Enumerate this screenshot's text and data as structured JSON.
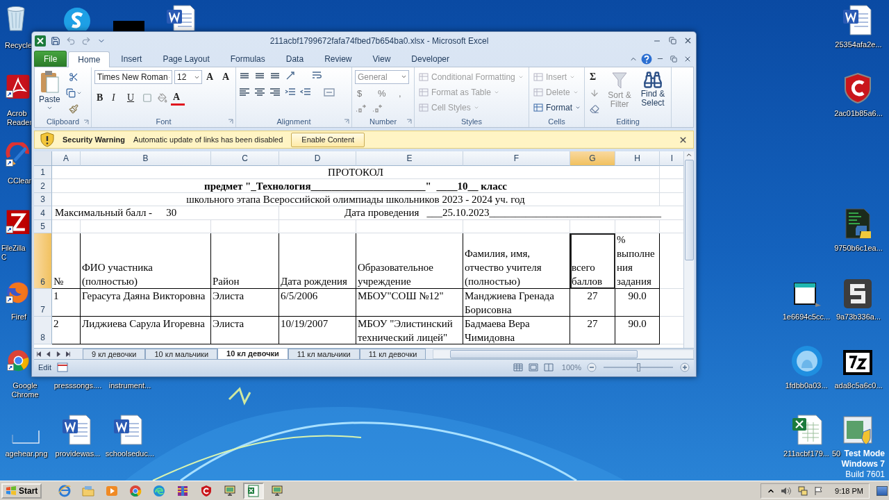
{
  "desktop": {
    "icons": [
      {
        "kind": "recycle",
        "label": "Recycle"
      },
      {
        "kind": "skype"
      },
      {
        "kind": "blackbox"
      },
      {
        "kind": "word"
      },
      {
        "kind": "acrobat",
        "label": "Acrob Reader"
      },
      {
        "kind": "ccleaner",
        "label": "CClear"
      },
      {
        "kind": "filezilla",
        "label": "FileZilla C"
      },
      {
        "kind": "firefox",
        "label": "Firef"
      },
      {
        "kind": "chrome",
        "label": "Google Chrome"
      },
      {
        "label": "presssongs...."
      },
      {
        "label": "instrument..."
      },
      {
        "kind": "imagefile",
        "label": "agehear.png"
      },
      {
        "kind": "word",
        "label": "providewas..."
      },
      {
        "kind": "word",
        "label": "schoolseduc..."
      },
      {
        "kind": "word",
        "label": "25354afa2e..."
      },
      {
        "kind": "shield",
        "label": "2ac01b85a6..."
      },
      {
        "kind": "python",
        "label": "9750b6c1ea..."
      },
      {
        "kind": "window",
        "label": "1e6694c5cc..."
      },
      {
        "kind": "sapp",
        "label": "9a73b336a..."
      },
      {
        "kind": "bubble",
        "label": "1fdbb0a03..."
      },
      {
        "kind": "sevenzip",
        "label": "ada8c5a6c0..."
      },
      {
        "kind": "excelfile",
        "label": "211acbf179..."
      },
      {
        "kind": "installer",
        "label": "50"
      }
    ],
    "notice": [
      "Test Mode",
      "Windows 7",
      "Build 7601"
    ]
  },
  "excel": {
    "title": "211acbf1799672fafa74fbed7b654ba0.xlsx - Microsoft Excel",
    "tabs": [
      {
        "label": "File",
        "kind": "file",
        "selected": false
      },
      {
        "label": "Home",
        "kind": "tab",
        "selected": true
      },
      {
        "label": "Insert",
        "kind": "tab",
        "selected": false
      },
      {
        "label": "Page Layout",
        "kind": "tab",
        "selected": false
      },
      {
        "label": "Formulas",
        "kind": "tab",
        "selected": false
      },
      {
        "label": "Data",
        "kind": "tab",
        "selected": false
      },
      {
        "label": "Review",
        "kind": "tab",
        "selected": false
      },
      {
        "label": "View",
        "kind": "tab",
        "selected": false
      },
      {
        "label": "Developer",
        "kind": "tab",
        "selected": false
      }
    ],
    "ribbon": [
      {
        "kind": "clipboard",
        "label": "Clipboard",
        "paste": "Paste"
      },
      {
        "kind": "font",
        "label": "Font",
        "font_name": "Times New Roman",
        "font_size": "12",
        "grow": "A",
        "shrink": "A",
        "bold": "B",
        "italic": "I",
        "underline": "U",
        "color_letter": "A"
      },
      {
        "kind": "alignment",
        "label": "Alignment"
      },
      {
        "kind": "number",
        "label": "Number",
        "format": "General",
        "symbols": [
          "$",
          "%",
          ","
        ]
      },
      {
        "kind": "styles",
        "label": "Styles",
        "items": [
          {
            "label": "Conditional Formatting",
            "disabled": true
          },
          {
            "label": "Format as Table",
            "disabled": true
          },
          {
            "label": "Cell Styles",
            "disabled": true
          }
        ]
      },
      {
        "kind": "cells",
        "label": "Cells",
        "items": [
          {
            "label": "Insert",
            "disabled": true
          },
          {
            "label": "Delete",
            "disabled": true
          },
          {
            "label": "Format",
            "disabled": false
          }
        ]
      },
      {
        "kind": "editing",
        "label": "Editing",
        "autosum": "Σ",
        "items": [
          {
            "label": "Sort & Filter",
            "disabled": true
          },
          {
            "label": "Find & Select",
            "disabled": false
          }
        ]
      }
    ],
    "security": {
      "title": "Security Warning",
      "message": "Automatic update of links has been disabled",
      "button": "Enable Content"
    },
    "columns": [
      {
        "label": "A",
        "selected": false
      },
      {
        "label": "B",
        "selected": false
      },
      {
        "label": "C",
        "selected": false
      },
      {
        "label": "D",
        "selected": false
      },
      {
        "label": "E",
        "selected": false
      },
      {
        "label": "F",
        "selected": false
      },
      {
        "label": "G",
        "selected": true
      },
      {
        "label": "H",
        "selected": false
      },
      {
        "label": "I",
        "selected": false
      }
    ],
    "rows": [
      {
        "number": "1",
        "selected": false,
        "kind": "title",
        "text": "ПРОТОКОЛ"
      },
      {
        "number": "2",
        "selected": false,
        "kind": "subtitle",
        "text": "предмет \"_Технология______________________\"  ____10__ класс"
      },
      {
        "number": "3",
        "selected": false,
        "kind": "title",
        "text": "школьного этапа Всероссийской олимпиады школьников 2023 - 2024 уч. год"
      },
      {
        "number": "4",
        "selected": false,
        "kind": "meta",
        "left": "Максимальный балл -",
        "value": "30",
        "right": "Дата проведения   ___25.10.2023_________________________________"
      },
      {
        "number": "5",
        "selected": false,
        "kind": "blank"
      },
      {
        "number": "6",
        "selected": true,
        "kind": "header",
        "cells": [
          "№",
          "ФИО участника (полностью)",
          "Район",
          "Дата рождения",
          "Образовательное учреждение",
          "Фамилия, имя, отчество учителя (полностью)",
          "всего баллов",
          "% выполнения задания"
        ]
      },
      {
        "number": "7",
        "selected": false,
        "kind": "data",
        "cells": [
          "1",
          "Герасута Даяна Викторовна",
          "Элиста",
          "6/5/2006",
          "МБОУ\"СОШ №12\"",
          "Манджиева Гренада Борисовна",
          "27",
          "90.0"
        ]
      },
      {
        "number": "8",
        "selected": false,
        "kind": "data",
        "cells": [
          "2",
          "Лиджиева Сарула Игоревна",
          "Элиста",
          "10/19/2007",
          "МБОУ \"Элистинский технический лицей\"",
          "Бадмаева Вера Чимидовна",
          "27",
          "90.0"
        ]
      }
    ],
    "sheets": [
      {
        "label": "9 кл девочки",
        "selected": false
      },
      {
        "label": "10 кл мальчики",
        "selected": false
      },
      {
        "label": "10 кл девочки",
        "selected": true
      },
      {
        "label": "11 кл мальчики",
        "selected": false
      },
      {
        "label": "11 кл девочки",
        "selected": false
      }
    ],
    "status": {
      "mode": "Edit",
      "zoom": {
        "reading": "100%",
        "level": 0.5
      }
    }
  },
  "taskbar": {
    "start": "Start",
    "apps": [
      {
        "kind": "ie",
        "selected": false
      },
      {
        "kind": "explorer",
        "selected": false
      },
      {
        "kind": "media",
        "selected": false
      },
      {
        "kind": "chrome",
        "selected": false
      },
      {
        "kind": "edge",
        "selected": false
      },
      {
        "kind": "winrar",
        "selected": false
      },
      {
        "kind": "comodo",
        "selected": false
      },
      {
        "kind": "monitor",
        "selected": false
      },
      {
        "kind": "excel",
        "selected": true
      },
      {
        "kind": "monitor",
        "selected": false
      }
    ],
    "clock": "9:18 PM"
  }
}
